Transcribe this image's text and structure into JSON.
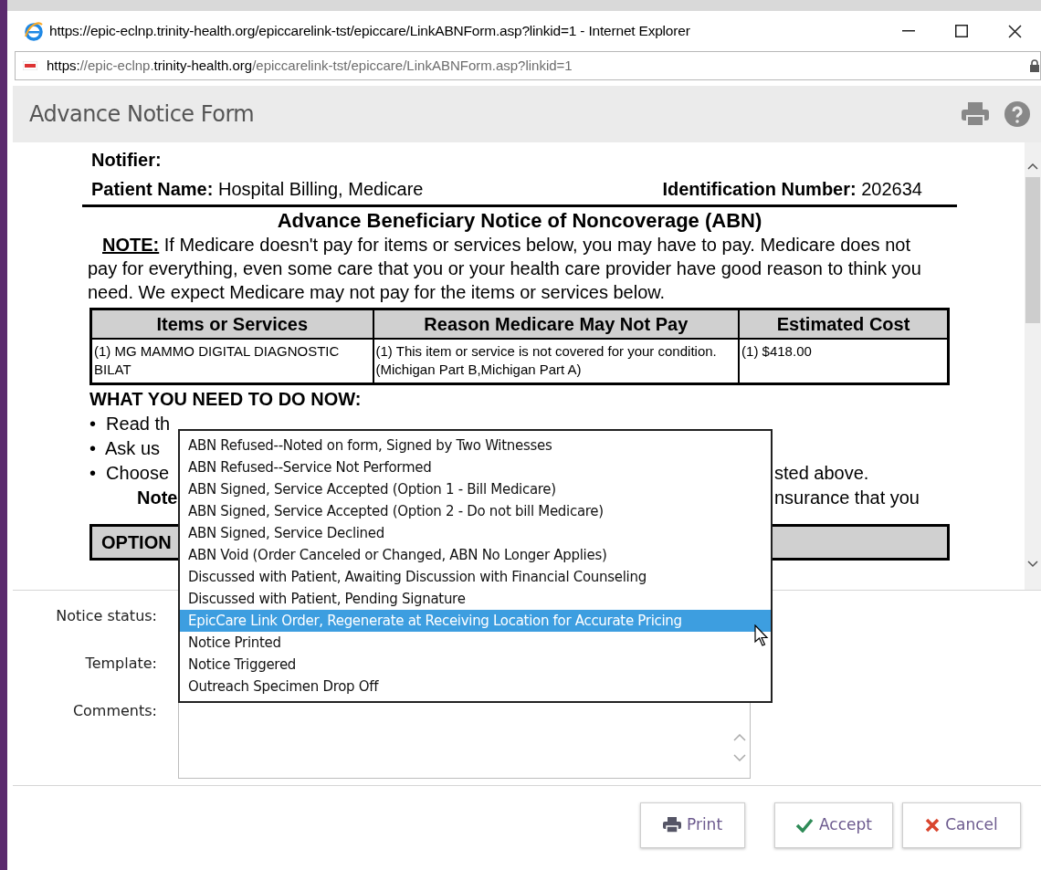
{
  "window": {
    "title": "https://epic-eclnp.trinity-health.org/epiccarelink-tst/epiccare/LinkABNForm.asp?linkid=1 - Internet Explorer"
  },
  "address_bar": {
    "url_parts": [
      {
        "text": "https:",
        "emphasis": true
      },
      {
        "text": "//epic-eclnp.",
        "emphasis": false
      },
      {
        "text": "trinity-health.org",
        "emphasis": true
      },
      {
        "text": "/epiccarelink-tst/epiccare/LinkABNForm.asp?linkid=1",
        "emphasis": false
      }
    ]
  },
  "header": {
    "title": "Advance Notice Form"
  },
  "document": {
    "notifier_label": "Notifier:",
    "patient_label": "Patient Name:",
    "patient_value": "Hospital Billing, Medicare",
    "id_label": "Identification Number:",
    "id_value": "202634",
    "title": "Advance Beneficiary Notice of Noncoverage (ABN)",
    "note_label": "NOTE:",
    "note_text": "If Medicare doesn't pay for items or services below, you may have to pay. Medicare does not pay for everything, even some care that you or your health care provider have good reason to think you need. We expect Medicare may not pay for the items or services below.",
    "table": {
      "columns": [
        "Items or Services",
        "Reason Medicare May Not Pay",
        "Estimated Cost"
      ],
      "rows": [
        [
          "(1) MG MAMMO DIGITAL DIAGNOSTIC BILAT",
          "(1) This item or service is not covered for your condition. (Michigan Part B,Michigan Part A)",
          "(1) $418.00"
        ]
      ]
    },
    "todo_heading": "WHAT YOU NEED TO DO NOW:",
    "todo_lines": [
      {
        "kind": "bullet",
        "left": "Read th"
      },
      {
        "kind": "bullet",
        "left": "Ask us"
      },
      {
        "kind": "bullet",
        "left": "Choose",
        "right": "sted above."
      },
      {
        "kind": "note",
        "left": "Note",
        "right": "nsurance that you"
      }
    ],
    "bullet_char": "•",
    "options_heading": "OPTION"
  },
  "form": {
    "labels": [
      "Notice status:",
      "Template:",
      "Comments:"
    ]
  },
  "dropdown": {
    "items": [
      {
        "label": "ABN Refused--Noted on form, Signed by Two Witnesses",
        "selected": false
      },
      {
        "label": "ABN Refused--Service Not Performed",
        "selected": false
      },
      {
        "label": "ABN Signed, Service Accepted (Option 1 - Bill Medicare)",
        "selected": false
      },
      {
        "label": "ABN Signed, Service Accepted (Option 2 - Do not bill Medicare)",
        "selected": false
      },
      {
        "label": "ABN Signed, Service Declined",
        "selected": false
      },
      {
        "label": "ABN Void (Order Canceled or Changed, ABN No Longer Applies)",
        "selected": false
      },
      {
        "label": "Discussed with Patient, Awaiting Discussion with Financial Counseling",
        "selected": false
      },
      {
        "label": "Discussed with Patient, Pending Signature",
        "selected": false
      },
      {
        "label": "EpicCare Link Order, Regenerate at Receiving Location for Accurate Pricing",
        "selected": true
      },
      {
        "label": "Notice Printed",
        "selected": false
      },
      {
        "label": "Notice Triggered",
        "selected": false
      },
      {
        "label": "Outreach Specimen Drop Off",
        "selected": false
      }
    ]
  },
  "buttons": [
    {
      "kind": "print",
      "label": "Print"
    },
    {
      "kind": "accept",
      "label": "Accept"
    },
    {
      "kind": "cancel",
      "label": "Cancel"
    }
  ]
}
